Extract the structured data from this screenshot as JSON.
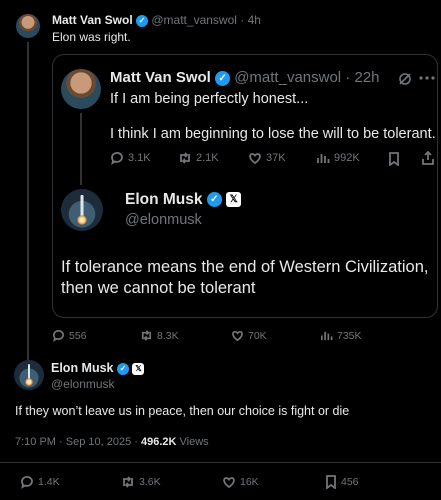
{
  "outer": {
    "author": "Matt Van Swol",
    "handle": "@matt_vanswol",
    "time": "4h",
    "text": "Elon was right.",
    "stats": {
      "replies": "556",
      "reposts": "8.3K",
      "likes": "70K",
      "views": "735K"
    }
  },
  "quoted": {
    "author": "Matt Van Swol",
    "handle": "@matt_vanswol",
    "time": "22h",
    "line1": "If I am being perfectly honest...",
    "line2": "I think I am beginning to lose the will to be tolerant.",
    "stats": {
      "replies": "3.1K",
      "reposts": "2.1K",
      "likes": "37K",
      "views": "992K"
    },
    "reply": {
      "author": "Elon Musk",
      "handle": "@elonmusk",
      "text": "If tolerance means the end of Western Civilization, then we cannot be tolerant"
    }
  },
  "main": {
    "author": "Elon Musk",
    "handle": "@elonmusk",
    "text": "If they won’t leave us in peace, then our choice is fight or die",
    "timestamp": "7:10 PM · Sep 10, 2025 · ",
    "views_count": "496.2K",
    "views_label": " Views",
    "stats": {
      "replies": "1.4K",
      "reposts": "3.6K",
      "likes": "16K",
      "bookmarks": "456"
    }
  },
  "colors": {
    "accent": "#1d9bf0",
    "muted": "#71767b",
    "border": "#2f3336"
  }
}
